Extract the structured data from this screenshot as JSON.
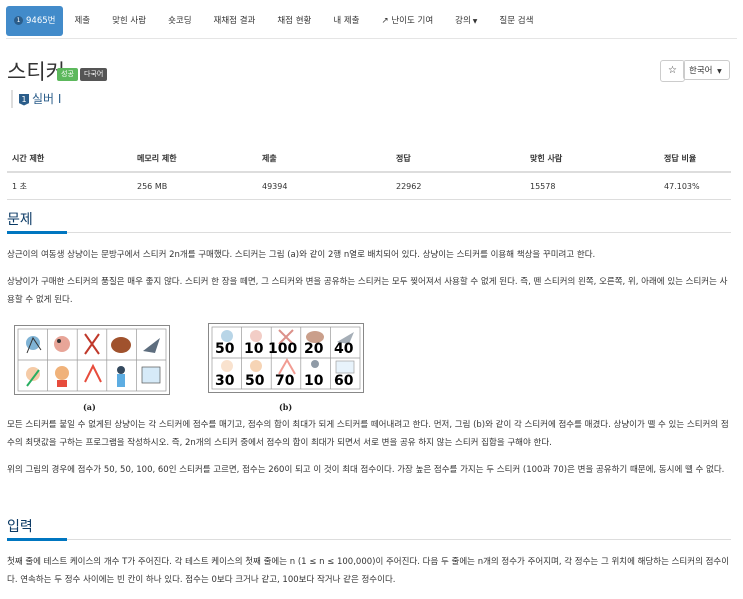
{
  "nav": {
    "tabs": [
      {
        "label": "9465번",
        "active": true,
        "badge": "1"
      },
      {
        "label": "제출"
      },
      {
        "label": "맞힌 사람"
      },
      {
        "label": "숏코딩"
      },
      {
        "label": "재채점 결과"
      },
      {
        "label": "채점 현황"
      },
      {
        "label": "내 제출"
      },
      {
        "label": "난이도 기여",
        "icon": "external-link-icon"
      },
      {
        "label": "강의",
        "caret": true
      },
      {
        "label": "질문 검색"
      }
    ]
  },
  "problem": {
    "title": "스티커",
    "labels": [
      "성공",
      "다국어"
    ],
    "tier": "실버 I",
    "tier_badge": "1",
    "star": "☆",
    "language_button": "한국어"
  },
  "stats": {
    "headers": [
      "시간 제한",
      "메모리 제한",
      "제출",
      "정답",
      "맞힌 사람",
      "정답 비율"
    ],
    "row": [
      "1 초",
      "256 MB",
      "49394",
      "22962",
      "15578",
      "47.103%"
    ]
  },
  "sections": {
    "problem_heading": "문제",
    "problem_p1": "상근이의 여동생 상냥이는 문방구에서 스티커 2n개를 구매했다. 스티커는 그림 (a)와 같이 2행 n열로 배치되어 있다. 상냥이는 스티커를 이용해 책상을 꾸미려고 한다.",
    "problem_p2": "상냥이가 구매한 스티커의 품질은 매우 좋지 않다. 스티커 한 장을 떼면, 그 스티커와 변을 공유하는 스티커는 모두 찢어져서 사용할 수 없게 된다. 즉, 뗀 스티커의 왼쪽, 오른쪽, 위, 아래에 있는 스티커는 사용할 수 없게 된다.",
    "figure_a_caption": "(a)",
    "figure_b_caption": "(b)",
    "figure_b_numbers_top": [
      "50",
      "10",
      "100",
      "20",
      "40"
    ],
    "figure_b_numbers_bottom": [
      "30",
      "50",
      "70",
      "10",
      "60"
    ],
    "problem_p3": "모든 스티커를 붙일 수 없게된 상냥이는 각 스티커에 점수를 매기고, 점수의 합이 최대가 되게 스티커를 떼어내려고 한다. 먼저, 그림 (b)와 같이 각 스티커에 점수를 매겼다. 상냥이가 뗄 수 있는 스티커의 점수의 최댓값을 구하는 프로그램을 작성하시오. 즉, 2n개의 스티커 중에서 점수의 합이 최대가 되면서 서로 변을 공유 하지 않는 스티커 집합을 구해야 한다.",
    "problem_p4": "위의 그림의 경우에 점수가 50, 50, 100, 60인 스티커를 고르면, 점수는 260이 되고 이 것이 최대 점수이다. 가장 높은 점수를 가지는 두 스티커 (100과 70)은 변을 공유하기 때문에, 동시에 뗄 수 없다.",
    "input_heading": "입력",
    "input_p1": "첫째 줄에 테스트 케이스의 개수 T가 주어진다. 각 테스트 케이스의 첫째 줄에는 n (1 ≤ n ≤ 100,000)이 주어진다. 다음 두 줄에는 n개의 정수가 주어지며, 각 정수는 그 위치에 해당하는 스티커의 점수이다. 연속하는 두 정수 사이에는 빈 칸이 하나 있다. 점수는 0보다 크거나 같고, 100보다 작거나 같은 정수이다."
  }
}
